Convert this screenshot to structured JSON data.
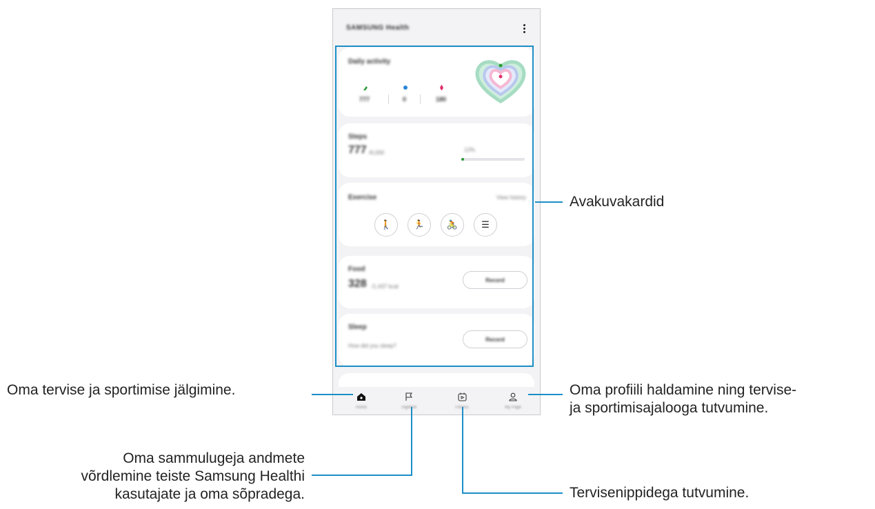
{
  "app": {
    "title": "SAMSUNG Health",
    "menu_icon": "more-vertical-icon"
  },
  "cards": {
    "daily_activity": {
      "title": "Daily activity",
      "stats": [
        {
          "icon": "steps-icon",
          "color": "#2c9a3a",
          "value": "777"
        },
        {
          "icon": "active-time-icon",
          "color": "#2a86d6",
          "value": "0"
        },
        {
          "icon": "calories-icon",
          "color": "#e0306a",
          "value": "180"
        }
      ],
      "ring_colors": [
        "#a6dcc2",
        "#b9c8ee",
        "#f5b8d2"
      ]
    },
    "steps": {
      "title": "Steps",
      "value": "777",
      "sub": "/6,000",
      "progress_label": "12%",
      "progress_fraction": 0.02,
      "progress_color": "#2c9a3a"
    },
    "exercise": {
      "title": "Exercise",
      "link": "View history",
      "buttons": [
        {
          "icon": "walking-icon",
          "glyph": "🚶"
        },
        {
          "icon": "running-icon",
          "glyph": "🏃"
        },
        {
          "icon": "cycling-icon",
          "glyph": "🚴"
        },
        {
          "icon": "list-icon",
          "glyph": "☰"
        }
      ]
    },
    "food": {
      "title": "Food",
      "value": "328",
      "sub": "/1,437 kcal",
      "button": "Record"
    },
    "sleep": {
      "title": "Sleep",
      "question": "How did you sleep?",
      "button": "Record"
    }
  },
  "nav": [
    {
      "icon": "home-icon",
      "label": "Home"
    },
    {
      "icon": "flag-icon",
      "label": "Together"
    },
    {
      "icon": "fitness-icon",
      "label": "Fitness"
    },
    {
      "icon": "person-icon",
      "label": "My Page"
    }
  ],
  "callouts": {
    "cards": "Avakuvakardid",
    "home": "Oma tervise ja sportimise jälgimine.",
    "together_line1": "Oma sammulugeja andmete",
    "together_line2": "võrdlemine teiste Samsung Healthi",
    "together_line3": "kasutajate ja oma sõpradega.",
    "fitness": "Tervisenippidega tutvumine.",
    "profile_line1": "Oma profiili haldamine ning tervise-",
    "profile_line2": "ja sportimisajalooga tutvumine."
  },
  "accent_color": "#1b8ec7"
}
